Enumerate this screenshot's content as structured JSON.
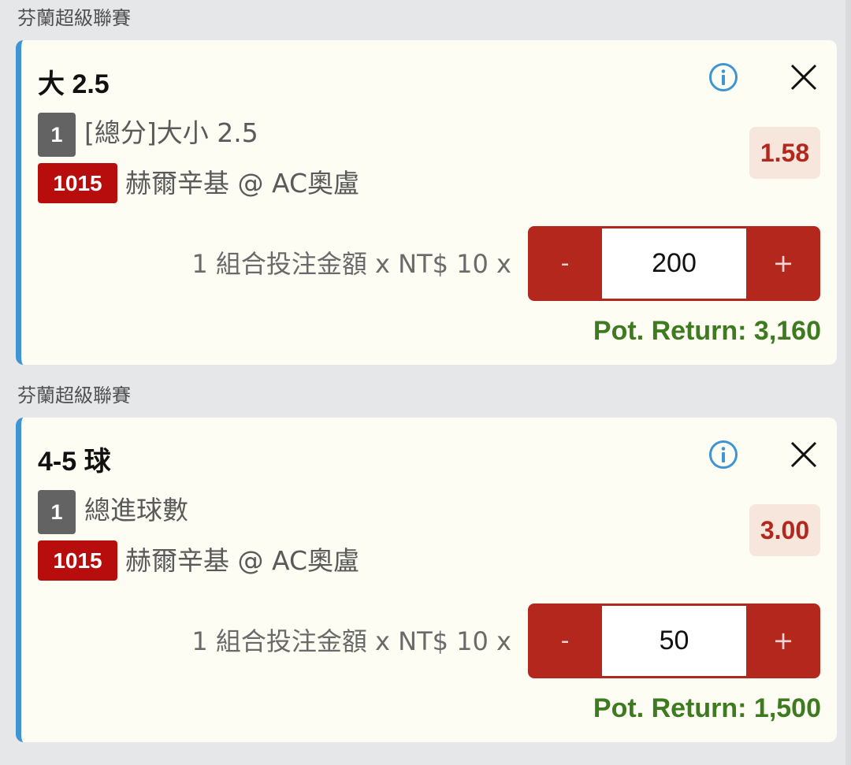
{
  "colors": {
    "accent_bar": "#3f94d4",
    "match_badge": "#b80d0d",
    "stepper": "#b3271d",
    "odds_text": "#b3271d",
    "pot_return": "#3e7a1f"
  },
  "bets": [
    {
      "league": "芬蘭超級聯賽",
      "selection": "大 2.5",
      "leg_count": "1",
      "market": "[總分]大小 2.5",
      "match_no": "1015",
      "match": "赫爾辛基 @ AC奧盧",
      "odds": "1.58",
      "stake_label": "1 組合投注金額 x NT$ 10 x",
      "stepper": {
        "minus": "-",
        "value": "200",
        "plus": "+"
      },
      "pot_return": "Pot. Return: 3,160",
      "info_icon": "info-icon",
      "close_icon": "close-icon"
    },
    {
      "league": "芬蘭超級聯賽",
      "selection": "4-5 球",
      "leg_count": "1",
      "market": "總進球數",
      "match_no": "1015",
      "match": "赫爾辛基 @ AC奧盧",
      "odds": "3.00",
      "stake_label": "1 組合投注金額 x NT$ 10 x",
      "stepper": {
        "minus": "-",
        "value": "50",
        "plus": "+"
      },
      "pot_return": "Pot. Return: 1,500",
      "info_icon": "info-icon",
      "close_icon": "close-icon"
    }
  ]
}
